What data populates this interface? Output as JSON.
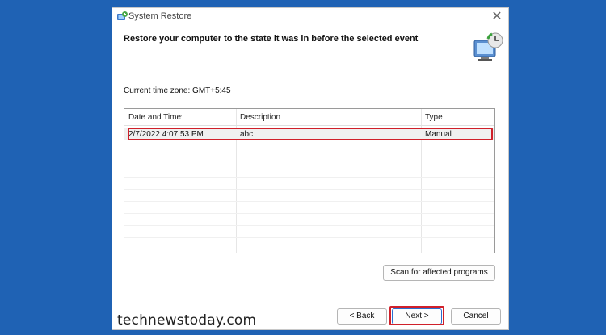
{
  "window": {
    "title": "System Restore",
    "close_glyph": "✕"
  },
  "header": {
    "heading": "Restore your computer to the state it was in before the selected event"
  },
  "timezone_label": "Current time zone: GMT+5:45",
  "table": {
    "columns": [
      "Date and Time",
      "Description",
      "Type"
    ],
    "rows": [
      {
        "date": "2/7/2022 4:07:53 PM",
        "description": "abc",
        "type": "Manual"
      }
    ]
  },
  "buttons": {
    "scan": "Scan for affected programs",
    "back": "< Back",
    "next": "Next >",
    "cancel": "Cancel"
  },
  "watermark": "technewstoday.com",
  "colors": {
    "desktop": "#1f62b4",
    "highlight": "#d0202a"
  },
  "icons": {
    "title": "system-restore-icon",
    "header": "restore-monitor-icon"
  }
}
